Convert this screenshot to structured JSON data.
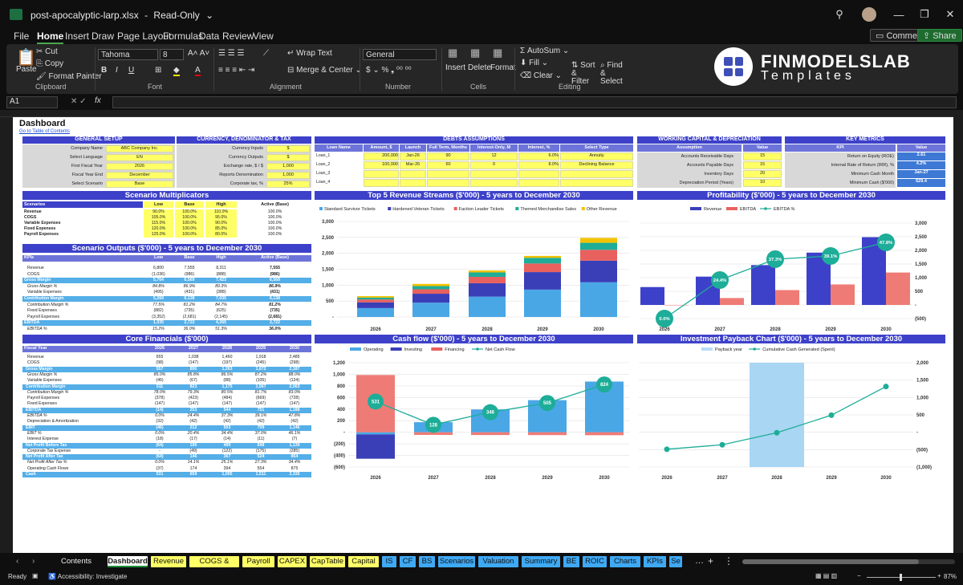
{
  "window": {
    "filename": "post-apocalyptic-larp.xlsx",
    "mode": "Read-Only"
  },
  "menu": [
    "File",
    "Home",
    "Insert",
    "Draw",
    "Page Layout",
    "Formulas",
    "Data",
    "Review",
    "View"
  ],
  "menu_right": {
    "comments": "Comments",
    "share": "Share"
  },
  "ribbon": {
    "clipboard": {
      "paste": "Paste",
      "cut": "Cut",
      "copy": "Copy",
      "format_painter": "Format Painter",
      "group": "Clipboard"
    },
    "font": {
      "name": "Tahoma",
      "size": "8",
      "group": "Font"
    },
    "alignment": {
      "wrap": "Wrap Text",
      "merge": "Merge & Center",
      "group": "Alignment"
    },
    "number": {
      "format": "General",
      "group": "Number"
    },
    "cells": {
      "insert": "Insert",
      "delete": "Delete",
      "format": "Format",
      "group": "Cells"
    },
    "editing": {
      "autosum": "AutoSum",
      "fill": "Fill",
      "clear": "Clear",
      "sort": "Sort & Filter",
      "find": "Find & Select",
      "group": "Editing"
    }
  },
  "logo": {
    "line1": "FINMODELSLAB",
    "line2": "Templates"
  },
  "formula_bar": {
    "cell": "A1",
    "fx": "fx"
  },
  "sheet": {
    "title": "Dashboard",
    "link": "Go to Table of Contents",
    "general_setup": {
      "header": "GENERAL SETUP",
      "rows": [
        [
          "Company Name",
          "ABC Company Inc."
        ],
        [
          "Select Language",
          "EN"
        ],
        [
          "First Fiscal Year",
          "2026"
        ],
        [
          "Fiscal Year End",
          "December"
        ],
        [
          "Select Scenario",
          "Base"
        ]
      ]
    },
    "currency": {
      "header": "CURRENCY, DENOMINATOR & TAX",
      "rows": [
        [
          "Currency Inputs",
          "$"
        ],
        [
          "Currency Outputs",
          "$"
        ],
        [
          "Exchange rate, $ / $",
          "1,000"
        ],
        [
          "Reports Denomination",
          "1,000"
        ],
        [
          "Corporate tax, %",
          "25%"
        ]
      ]
    },
    "debts": {
      "header": "DEBTS ASSUMPTIONS",
      "cols": [
        "Loan Name",
        "Amount, $",
        "Launch",
        "Full Term, Months",
        "Interest-Only, M",
        "Interest, %",
        "Select Type"
      ],
      "rows": [
        [
          "Loan_1",
          "200,000",
          "Jan-26",
          "90",
          "12",
          "6.0%",
          "Annuity"
        ],
        [
          "Loan_2",
          "100,000",
          "Mar-26",
          "60",
          "0",
          "8.0%",
          "Declining Balance"
        ],
        [
          "Loan_3",
          "",
          "",
          "",
          "",
          "",
          ""
        ],
        [
          "Loan_4",
          "",
          "",
          "",
          "",
          "",
          ""
        ]
      ]
    },
    "working_capital": {
      "header": "WORKING CAPITAL & DEPRECIATION",
      "cols": [
        "Assumption",
        "Value"
      ],
      "rows": [
        [
          "Accounts Receivable Days",
          "15"
        ],
        [
          "Accounts Payable Days",
          "15"
        ],
        [
          "Inventory Days",
          "20"
        ],
        [
          "Depreciation Period (Years)",
          "10"
        ]
      ]
    },
    "key_metrics": {
      "header": "KEY METRICS",
      "cols": [
        "KPI",
        "Value"
      ],
      "rows": [
        [
          "Return on Equity (ROE)",
          "2.61"
        ],
        [
          "Internal Rate of Return (IRR), %",
          "4.2%"
        ],
        [
          "Minimum Cash Month",
          "Jan-27"
        ],
        [
          "Minimum Cash ($'000)",
          "529.4"
        ]
      ]
    },
    "scenario_mult": {
      "header": "Scenario Multiplicators",
      "cols": [
        "Scenarios",
        "Low",
        "Base",
        "High",
        "Active (Base)"
      ],
      "rows": [
        [
          "Revenue",
          "90.0%",
          "100.0%",
          "110.0%",
          "100.0%"
        ],
        [
          "COGS",
          "105.0%",
          "100.0%",
          "95.0%",
          "100.0%"
        ],
        [
          "Variable Expenses",
          "115.0%",
          "100.0%",
          "90.0%",
          "100.0%"
        ],
        [
          "Fixed Expenses",
          "120.0%",
          "100.0%",
          "85.0%",
          "100.0%"
        ],
        [
          "Payroll Expenses",
          "125.0%",
          "100.0%",
          "80.0%",
          "100.0%"
        ]
      ]
    },
    "scenario_out": {
      "header": "Scenario Outputs ($'000) - 5 years to December 2030",
      "cols": [
        "KPIs",
        "Low",
        "Base",
        "High",
        "Active (Base)"
      ],
      "rows": [
        [
          "Revenue",
          "6,800",
          "7,555",
          "8,311",
          "7,555"
        ],
        [
          "COGS",
          "(1,036)",
          "(986)",
          "(888)",
          "(986)"
        ],
        [
          "Gross Margin",
          "5,764",
          "6,569",
          "7,423",
          "6,569"
        ],
        [
          "Gross Margin %",
          "84.8%",
          "86.9%",
          "89.3%",
          "86.9%"
        ],
        [
          "Variable Expenses",
          "(495)",
          "(431)",
          "(388)",
          "(431)"
        ],
        [
          "Contribution Margin",
          "5,269",
          "6,138",
          "7,035",
          "6,138"
        ],
        [
          "Contribution Margin %",
          "77.5%",
          "81.2%",
          "84.7%",
          "81.2%"
        ],
        [
          "Fixed Expenses",
          "(882)",
          "(735)",
          "(625)",
          "(735)"
        ],
        [
          "Payroll Expenses",
          "(3,352)",
          "(2,681)",
          "(2,145)",
          "(2,681)"
        ],
        [
          "EBITDA",
          "1,035",
          "2,722",
          "4,265",
          "2,722"
        ],
        [
          "EBITDA %",
          "15.2%",
          "36.0%",
          "51.3%",
          "36.0%"
        ]
      ]
    },
    "core_fin": {
      "header": "Core Financials ($'000)",
      "cols": [
        "Fiscal Year",
        "2026",
        "2027",
        "2028",
        "2029",
        "2030"
      ],
      "rows": [
        [
          "Revenue",
          "655",
          "1,038",
          "1,460",
          "1,918",
          "2,485"
        ],
        [
          "COGS",
          "(98)",
          "(147)",
          "(197)",
          "(245)",
          "(298)"
        ],
        [
          "Gross Margin",
          "557",
          "890",
          "1,263",
          "1,672",
          "2,187"
        ],
        [
          "Gross Margin %",
          "85.0%",
          "85.8%",
          "86.5%",
          "87.2%",
          "88.0%"
        ],
        [
          "Variable Expenses",
          "(46)",
          "(67)",
          "(88)",
          "(105)",
          "(124)"
        ],
        [
          "Contribution Margin",
          "511",
          "823",
          "1,175",
          "1,567",
          "2,063"
        ],
        [
          "Contribution Margin %",
          "78.0%",
          "79.3%",
          "80.5%",
          "81.7%",
          "83.0%"
        ],
        [
          "Payroll Expenses",
          "(378)",
          "(423)",
          "(484)",
          "(669)",
          "(728)"
        ],
        [
          "Fixed Expenses",
          "(147)",
          "(147)",
          "(147)",
          "(147)",
          "(147)"
        ],
        [
          "EBITDA",
          "(14)",
          "253",
          "544",
          "751",
          "1,188"
        ],
        [
          "EBITDA %",
          "0.0%",
          "24.4%",
          "37.3%",
          "39.1%",
          "47.8%"
        ],
        [
          "Depreciation & Amortization",
          "(32)",
          "(42)",
          "(42)",
          "(42)",
          "(42)"
        ],
        [
          "EBIT",
          "(46)",
          "212",
          "503",
          "709",
          "1,146"
        ],
        [
          "EBIT %",
          "0.0%",
          "20.4%",
          "34.4%",
          "37.0%",
          "46.1%"
        ],
        [
          "Interest Expense",
          "(18)",
          "(17)",
          "(14)",
          "(11)",
          "(7)"
        ],
        [
          "Net Profit Before Tax",
          "(64)",
          "195",
          "489",
          "698",
          "1,139"
        ],
        [
          "Corporate Tax Expense",
          "-",
          "(49)",
          "(122)",
          "(175)",
          "(285)"
        ],
        [
          "Net Profit After Tax",
          "(64)",
          "146",
          "367",
          "524",
          "854"
        ],
        [
          "Net Profit After Tax %",
          "0.0%",
          "14.1%",
          "25.1%",
          "27.3%",
          "34.4%"
        ],
        [
          "Operating Cash Flows",
          "(37)",
          "174",
          "394",
          "554",
          "875"
        ],
        [
          "Cash",
          "531",
          "659",
          "1,005",
          "1,511",
          "2,335"
        ]
      ]
    }
  },
  "charts": {
    "revenue": {
      "title": "Top 5 Revenue Streams ($'000) - 5 years to December 2030",
      "legend": [
        "Standard Survivor Tickets",
        "Hardened Veteran Tickets",
        "Faction Leader Tickets",
        "Themed Merchandise Sales",
        "Other Revenue"
      ],
      "yticks": [
        "-",
        "500",
        "1,000",
        "1,500",
        "2,000",
        "2,500",
        "3,000"
      ]
    },
    "profit": {
      "title": "Profitability ($'000) - 5 years to December 2030",
      "legend": [
        "Revenue",
        "EBITDA",
        "EBITDA %"
      ],
      "yticks": [
        "(500)",
        "-",
        "500",
        "1,000",
        "1,500",
        "2,000",
        "2,500",
        "3,000"
      ],
      "pct_labels": [
        "0.0%",
        "24.4%",
        "37.3%",
        "39.1%",
        "47.8%"
      ]
    },
    "cash": {
      "title": "Cash flow ($'000) - 5 years to December 2030",
      "legend": [
        "Operating",
        "Investing",
        "Financing",
        "Net Cash Flow"
      ],
      "yticks": [
        "(600)",
        "(400)",
        "(200)",
        "-",
        "200",
        "400",
        "600",
        "800",
        "1,000",
        "1,200"
      ],
      "bubbles": [
        "531",
        "128",
        "346",
        "505",
        "824"
      ]
    },
    "payback": {
      "title": "Investment Payback Chart ($'000) - 5 years to December 2030",
      "legend": [
        "Payback year",
        "Cumulative Cash Generated (Spent)"
      ],
      "yticks": [
        "(1,000)",
        "(500)",
        "-",
        "500",
        "1,000",
        "1,500",
        "2,000"
      ]
    },
    "years": [
      "2026",
      "2027",
      "2028",
      "2029",
      "2030"
    ]
  },
  "chart_data": [
    {
      "type": "bar",
      "title": "Top 5 Revenue Streams ($'000) - 5 years to December 2030",
      "categories": [
        "2026",
        "2027",
        "2028",
        "2029",
        "2030"
      ],
      "ylim": [
        0,
        3000
      ],
      "series": [
        {
          "name": "Standard Survivor Tickets",
          "values": [
            280,
            450,
            640,
            860,
            1090
          ]
        },
        {
          "name": "Hardened Veteran Tickets",
          "values": [
            180,
            280,
            420,
            550,
            680
          ]
        },
        {
          "name": "Faction Leader Tickets",
          "values": [
            90,
            140,
            200,
            270,
            340
          ]
        },
        {
          "name": "Themed Merchandise Sales",
          "values": [
            60,
            100,
            140,
            180,
            220
          ]
        },
        {
          "name": "Other Revenue",
          "values": [
            45,
            68,
            60,
            58,
            155
          ]
        }
      ]
    },
    {
      "type": "bar",
      "title": "Profitability ($'000) - 5 years to December 2030",
      "categories": [
        "2026",
        "2027",
        "2028",
        "2029",
        "2030"
      ],
      "ylim": [
        -500,
        3000
      ],
      "series": [
        {
          "name": "Revenue",
          "values": [
            655,
            1038,
            1460,
            1918,
            2485
          ]
        },
        {
          "name": "EBITDA",
          "values": [
            -14,
            253,
            544,
            751,
            1188
          ]
        },
        {
          "name": "EBITDA %",
          "values": [
            0,
            24.4,
            37.3,
            39.1,
            47.8
          ]
        }
      ]
    },
    {
      "type": "bar",
      "title": "Cash flow ($'000) - 5 years to December 2030",
      "categories": [
        "2026",
        "2027",
        "2028",
        "2029",
        "2030"
      ],
      "ylim": [
        -600,
        1200
      ],
      "series": [
        {
          "name": "Operating",
          "values": [
            -37,
            174,
            394,
            554,
            875
          ]
        },
        {
          "name": "Investing",
          "values": [
            -420,
            0,
            0,
            0,
            0
          ]
        },
        {
          "name": "Financing",
          "values": [
            988,
            -46,
            -48,
            -49,
            -51
          ]
        },
        {
          "name": "Net Cash Flow",
          "values": [
            531,
            128,
            346,
            505,
            824
          ]
        }
      ]
    },
    {
      "type": "line",
      "title": "Investment Payback Chart ($'000) - 5 years to December 2030",
      "categories": [
        "2026",
        "2027",
        "2028",
        "2029",
        "2030"
      ],
      "ylim": [
        -1000,
        2000
      ],
      "series": [
        {
          "name": "Payback year",
          "values": [
            0,
            0,
            1,
            0,
            0
          ]
        },
        {
          "name": "Cumulative Cash Generated (Spent)",
          "values": [
            -488,
            -360,
            -14,
            491,
            1315
          ]
        }
      ]
    }
  ],
  "tabs": [
    {
      "label": "Contents",
      "color": "#0f0f0f",
      "text": "#eee"
    },
    {
      "label": "Dashboard",
      "color": "#ffffff",
      "text": "#111"
    },
    {
      "label": "Revenue",
      "color": "#ffff66",
      "text": "#111"
    },
    {
      "label": "COGS & OPEX",
      "color": "#ffff66",
      "text": "#111"
    },
    {
      "label": "Payroll",
      "color": "#ffff66",
      "text": "#111"
    },
    {
      "label": "CAPEX",
      "color": "#ffff66",
      "text": "#111"
    },
    {
      "label": "CapTable",
      "color": "#ffff66",
      "text": "#111"
    },
    {
      "label": "Capital",
      "color": "#ffff66",
      "text": "#111"
    },
    {
      "label": "IS",
      "color": "#3fa9f5",
      "text": "#111"
    },
    {
      "label": "CF",
      "color": "#3fa9f5",
      "text": "#111"
    },
    {
      "label": "BS",
      "color": "#3fa9f5",
      "text": "#111"
    },
    {
      "label": "Scenarios",
      "color": "#3fa9f5",
      "text": "#111"
    },
    {
      "label": "Valuation",
      "color": "#3fa9f5",
      "text": "#111"
    },
    {
      "label": "Summary",
      "color": "#3fa9f5",
      "text": "#111"
    },
    {
      "label": "BE",
      "color": "#3fa9f5",
      "text": "#111"
    },
    {
      "label": "ROIC",
      "color": "#3fa9f5",
      "text": "#111"
    },
    {
      "label": "Charts",
      "color": "#3fa9f5",
      "text": "#111"
    },
    {
      "label": "KPIs",
      "color": "#3fa9f5",
      "text": "#111"
    },
    {
      "label": "Se",
      "color": "#3fa9f5",
      "text": "#111"
    }
  ],
  "status": {
    "ready": "Ready",
    "accessibility": "Accessibility: Investigate",
    "zoom": "87%"
  }
}
